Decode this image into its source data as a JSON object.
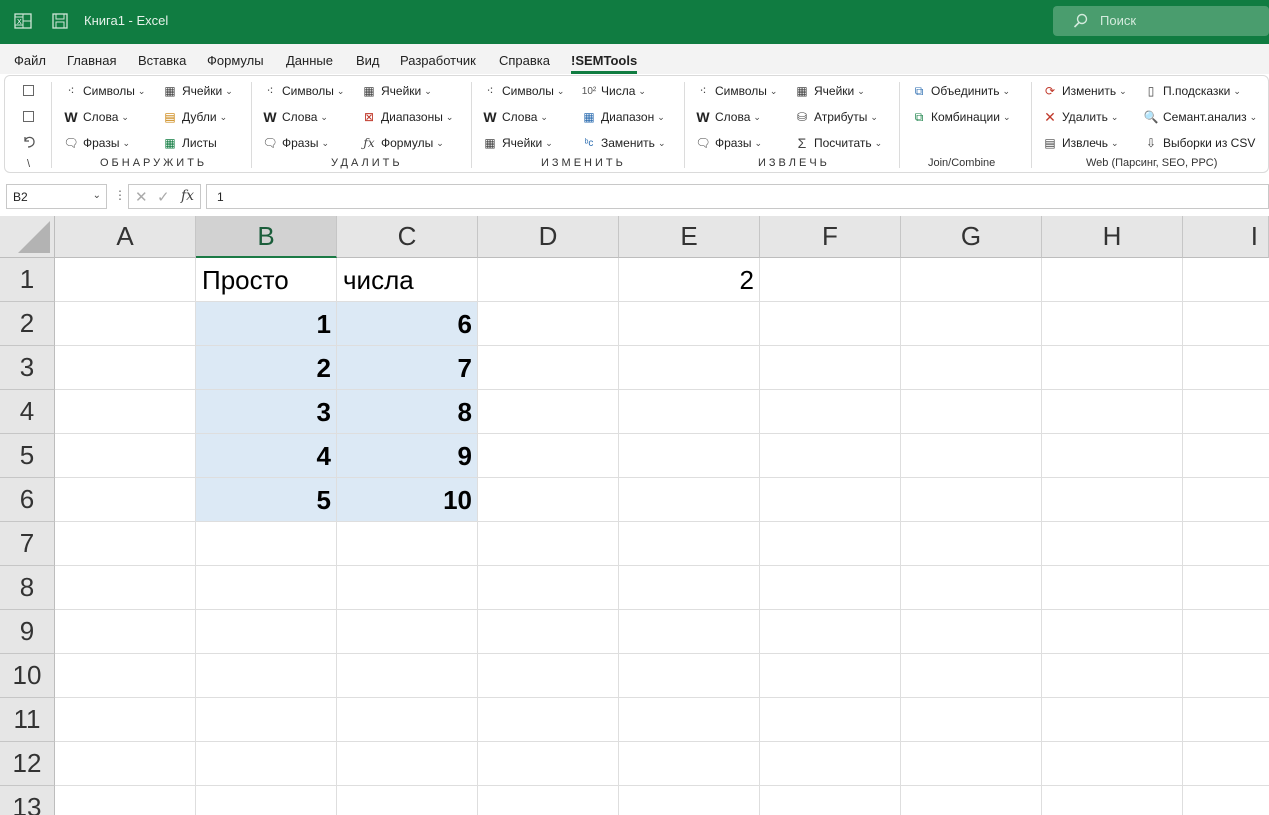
{
  "window": {
    "title": "Книга1  -  Excel",
    "search_placeholder": "Поиск",
    "accent": "#107c41"
  },
  "menu": {
    "tabs": [
      "Файл",
      "Главная",
      "Вставка",
      "Формулы",
      "Данные",
      "Вид",
      "Разработчик",
      "Справка",
      "!SEMTools"
    ],
    "active": "!SEMTools"
  },
  "ribbon": {
    "left_glyph": "\\",
    "detect": {
      "b1": "Символы",
      "b2": "Слова",
      "b3": "Фразы",
      "b4": "Ячейки",
      "b5": "Дубли",
      "b6": "Листы",
      "label": "ОБНАРУЖИТЬ"
    },
    "remove": {
      "b1": "Символы",
      "b2": "Слова",
      "b3": "Фразы",
      "b4": "Ячейки",
      "b5": "Диапазоны",
      "b6": "Формулы",
      "label": "УДАЛИТЬ"
    },
    "change": {
      "b1": "Символы",
      "b2": "Слова",
      "b3": "Ячейки",
      "b4": "Числа",
      "b5": "Диапазон",
      "b6": "Заменить",
      "label": "ИЗМЕНИТЬ"
    },
    "extract": {
      "b1": "Символы",
      "b2": "Слова",
      "b3": "Фразы",
      "b4": "Ячейки",
      "b5": "Атрибуты",
      "b6": "Посчитать",
      "label": "ИЗВЛЕЧЬ"
    },
    "join": {
      "b1": "Объединить",
      "b2": "Комбинации",
      "label": "Join/Combine"
    },
    "web": {
      "b1": "Изменить",
      "b2": "Удалить",
      "b3": "Извлечь",
      "b4": "П.подсказки",
      "b5": "Семант.анализ",
      "b6": "Выборки из CSV",
      "label": "Web (Парсинг, SEO, PPC)"
    }
  },
  "formula_bar": {
    "name_box": "B2",
    "fx": "fx",
    "value": "1"
  },
  "grid": {
    "columns": [
      "A",
      "B",
      "C",
      "D",
      "E",
      "F",
      "G",
      "H",
      "I"
    ],
    "rows": [
      "1",
      "2",
      "3",
      "4",
      "5",
      "6",
      "7",
      "8",
      "9",
      "10",
      "11",
      "12",
      "13"
    ],
    "selected_column": "B",
    "cells": {
      "B1": "Просто",
      "C1": "числа",
      "E1": "2",
      "B2": "1",
      "C2": "6",
      "B3": "2",
      "C3": "7",
      "B4": "3",
      "C4": "8",
      "B5": "4",
      "C5": "9",
      "B6": "5",
      "C6": "10"
    }
  }
}
